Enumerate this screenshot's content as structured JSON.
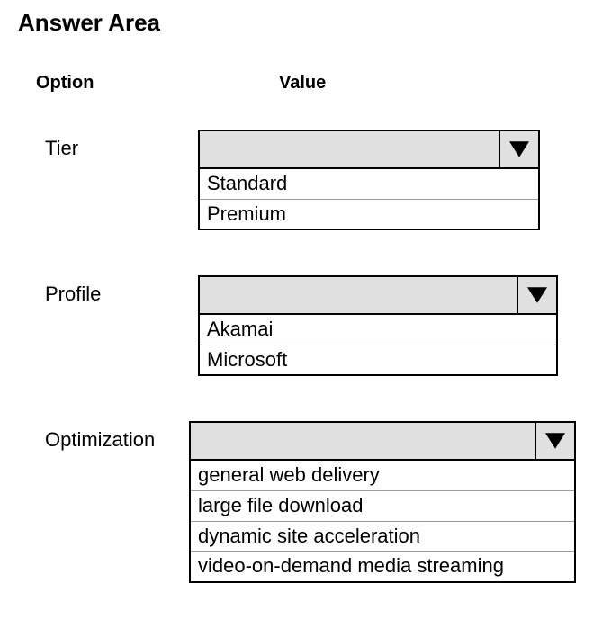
{
  "title": "Answer Area",
  "headers": {
    "option": "Option",
    "value": "Value"
  },
  "fields": {
    "tier": {
      "label": "Tier",
      "selected": "",
      "options": [
        "Standard",
        "Premium"
      ]
    },
    "profile": {
      "label": "Profile",
      "selected": "",
      "options": [
        "Akamai",
        "Microsoft"
      ]
    },
    "optimization": {
      "label": "Optimization",
      "selected": "",
      "options": [
        "general web delivery",
        "large file download",
        "dynamic site acceleration",
        "video-on-demand media streaming"
      ]
    }
  }
}
